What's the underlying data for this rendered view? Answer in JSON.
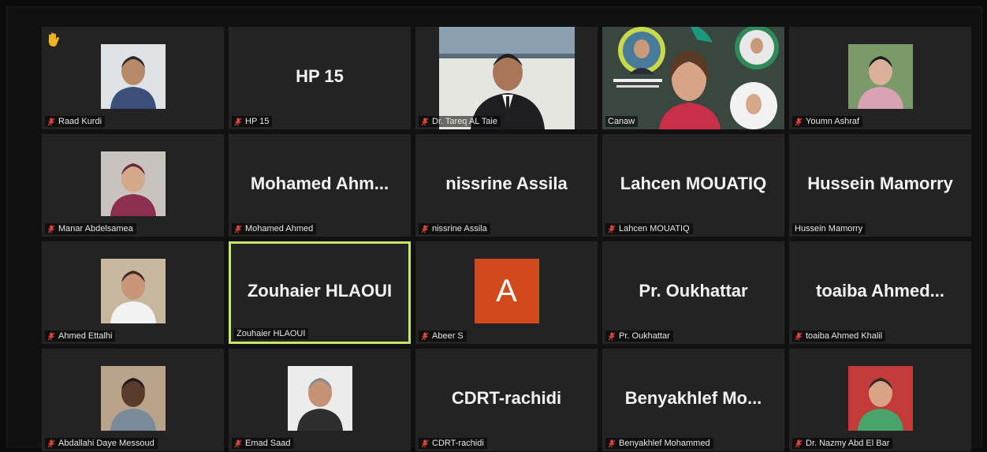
{
  "tiles": [
    {
      "name": "Raad Kurdi",
      "tag": "Raad Kurdi",
      "type": "photo",
      "muted": true,
      "hand": true,
      "photo": {
        "bg": "#dfe3e6",
        "skin": "#b98a6a",
        "shirt": "#3b4f7a",
        "hair": "#2a2a2a"
      }
    },
    {
      "name": "HP 15",
      "tag": "HP 15",
      "type": "text",
      "muted": true
    },
    {
      "name": "Dr. Tareq AL Taie",
      "tag": "Dr. Tareq AL Taie",
      "type": "video-man",
      "muted": true
    },
    {
      "name": "Canaw",
      "tag": "Canaw",
      "type": "video-collage",
      "muted": false
    },
    {
      "name": "Youmn Ashraf",
      "tag": "Youmn Ashraf",
      "type": "photo",
      "muted": true,
      "photo": {
        "bg": "#7a9a6a",
        "skin": "#d9b09a",
        "shirt": "#d9a3b5",
        "hair": "#1d1d1d"
      }
    },
    {
      "name": "Manar Abdelsamea",
      "tag": "Manar Abdelsamea",
      "type": "photo",
      "muted": true,
      "photo": {
        "bg": "#c9c3bd",
        "skin": "#d4a88a",
        "shirt": "#8c2f4f",
        "hair": "#6a2a3a"
      }
    },
    {
      "name": "Mohamed  Ahm...",
      "tag": "Mohamed Ahmed",
      "type": "text",
      "muted": true
    },
    {
      "name": "nissrine Assila",
      "tag": "nissrine Assila",
      "type": "text",
      "muted": true
    },
    {
      "name": "Lahcen MOUATIQ",
      "tag": "Lahcen MOUATIQ",
      "type": "text",
      "muted": true
    },
    {
      "name": "Hussein Mamorry",
      "tag": "Hussein Mamorry",
      "type": "text",
      "muted": false
    },
    {
      "name": "Ahmed Ettalhi",
      "tag": "Ahmed Ettalhi",
      "type": "photo",
      "muted": true,
      "photo": {
        "bg": "#c7b79f",
        "skin": "#c89578",
        "shirt": "#f2f2f2",
        "hair": "#3a2a22"
      }
    },
    {
      "name": "Zouhaier HLAOUI",
      "tag": "Zouhaier HLAOUI",
      "type": "text",
      "muted": false,
      "active": true
    },
    {
      "name": "A",
      "tag": "Abeer S",
      "type": "initial",
      "muted": true
    },
    {
      "name": "Pr. Oukhattar",
      "tag": "Pr. Oukhattar",
      "type": "text",
      "muted": true
    },
    {
      "name": "toaiba  Ahmed...",
      "tag": "toaiba Ahmed Khalil",
      "type": "text",
      "muted": true
    },
    {
      "name": "Abdallahi Daye Messoud",
      "tag": "Abdallahi Daye Messoud",
      "type": "photo",
      "muted": true,
      "photo": {
        "bg": "#b9a38a",
        "skin": "#5a3a2a",
        "shirt": "#7a8a9a",
        "hair": "#1b1b1b"
      }
    },
    {
      "name": "Emad Saad",
      "tag": "Emad Saad",
      "type": "photo",
      "muted": true,
      "photo": {
        "bg": "#ececec",
        "skin": "#c49276",
        "shirt": "#2e2e2e",
        "hair": "#8a8a8a"
      }
    },
    {
      "name": "CDRT-rachidi",
      "tag": "CDRT-rachidi",
      "type": "text",
      "muted": true
    },
    {
      "name": "Benyakhlef  Mo...",
      "tag": "Benyakhlef Mohammed",
      "type": "text",
      "muted": true
    },
    {
      "name": "Dr. Nazmy Abd El Bar",
      "tag": "Dr. Nazmy Abd El Bar",
      "type": "photo",
      "muted": true,
      "photo": {
        "bg": "#c23a3a",
        "skin": "#d9a486",
        "shirt": "#4aa36a",
        "hair": "#2a2a2a"
      }
    }
  ],
  "colors": {
    "muted_mic": "#e0443a",
    "active_border": "#c8e56a",
    "initial_bg": "#d14a1e"
  }
}
